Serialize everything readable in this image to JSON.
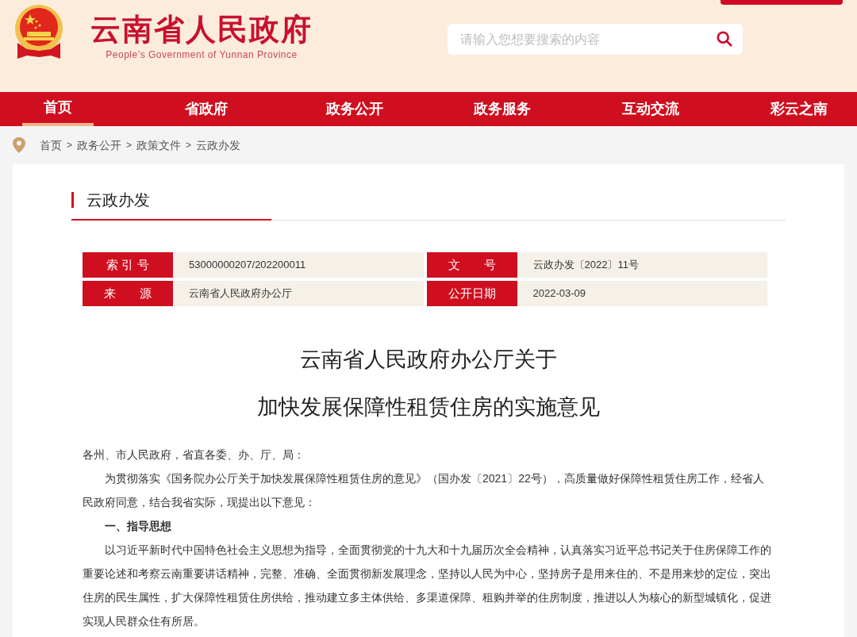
{
  "header": {
    "title": "云南省人民政府",
    "subtitle": "People’s Government of Yunnan Province",
    "search": {
      "placeholder": "请输入您想要搜索的内容"
    }
  },
  "nav": [
    {
      "label": "首页",
      "selected": true
    },
    {
      "label": "省政府",
      "selected": false
    },
    {
      "label": "政务公开",
      "selected": false
    },
    {
      "label": "政务服务",
      "selected": false
    },
    {
      "label": "互动交流",
      "selected": false
    },
    {
      "label": "彩云之南",
      "selected": false
    }
  ],
  "breadcrumb": [
    "首页",
    "政务公开",
    "政策文件",
    "云政办发"
  ],
  "breadcrumb_separator": ">",
  "section_title": "云政办发",
  "meta": [
    {
      "label": "索 引 号",
      "value": "53000000207/202200011"
    },
    {
      "label": "文　　号",
      "value": "云政办发〔2022〕11号"
    },
    {
      "label": "来　　源",
      "value": "云南省人民政府办公厅"
    },
    {
      "label": "公开日期",
      "value": "2022-03-09"
    }
  ],
  "article": {
    "title_lines": [
      "云南省人民政府办公厅关于",
      "加快发展保障性租赁住房的实施意见"
    ],
    "paragraphs": [
      {
        "kind": "salutation",
        "text": "各州、市人民政府，省直各委、办、厅、局："
      },
      {
        "kind": "body",
        "text": "为贯彻落实《国务院办公厅关于加快发展保障性租赁住房的意见》（国办发〔2021〕22号），高质量做好保障性租赁住房工作，经省人民政府同意，结合我省实际，现提出以下意见："
      },
      {
        "kind": "heading",
        "text": "一、指导思想"
      },
      {
        "kind": "body",
        "text": "以习近平新时代中国特色社会主义思想为指导，全面贯彻党的十九大和十九届历次全会精神，认真落实习近平总书记关于住房保障工作的重要论述和考察云南重要讲话精神，完整、准确、全面贯彻新发展理念，坚持以人民为中心，坚持房子是用来住的、不是用来炒的定位，突出住房的民生属性，扩大保障性租赁住房供给，推动建立多主体供给、多渠道保障、租购并举的住房制度，推进以人为核心的新型城镇化，促进实现人民群众住有所居。"
      }
    ]
  }
}
